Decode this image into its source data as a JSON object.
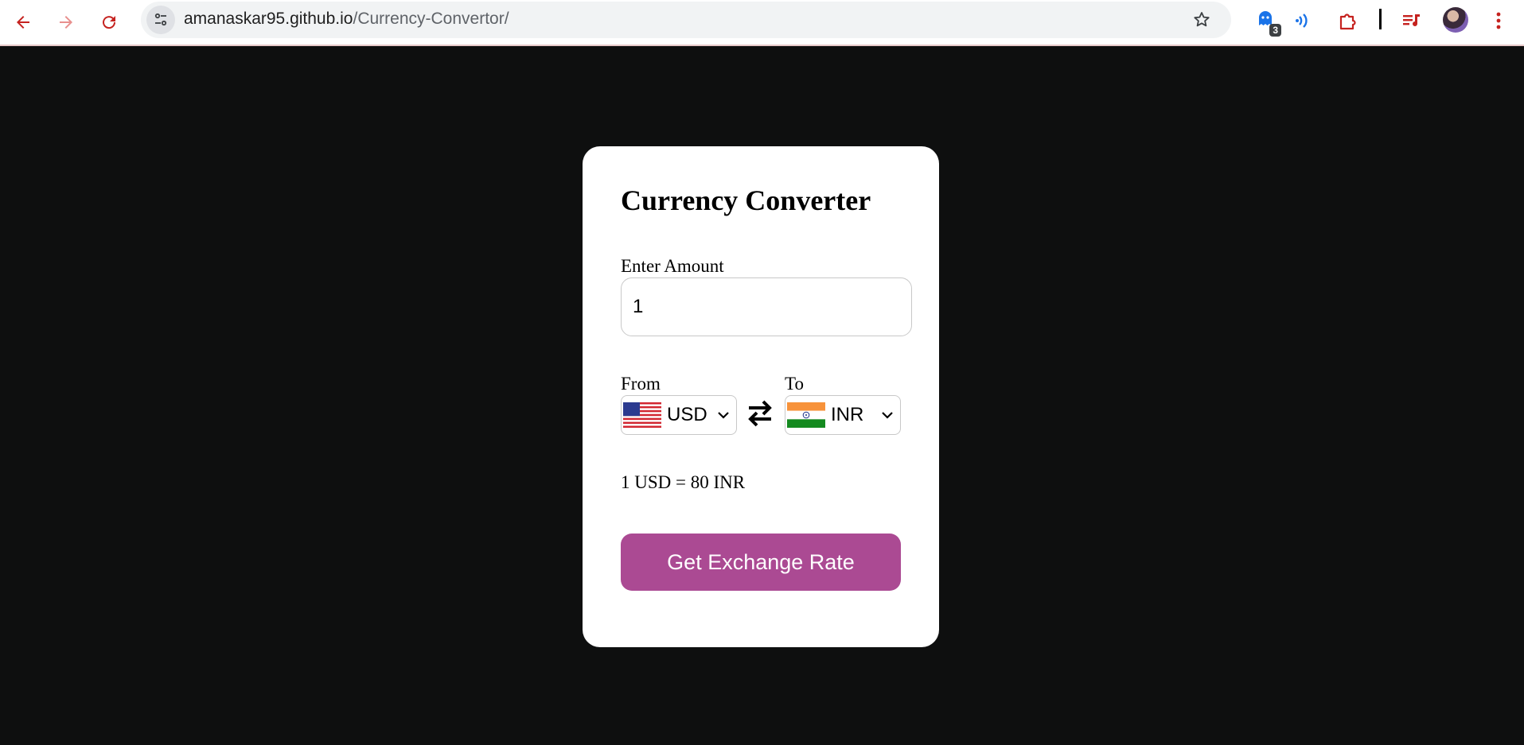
{
  "browser": {
    "url_host": "amanaskar95.github.io",
    "url_path": "/Currency-Convertor/",
    "extension_badge": "3",
    "icons": [
      "back-arrow-icon",
      "forward-arrow-icon",
      "reload-icon",
      "site-info-icon",
      "bookmark-star-icon",
      "extension-icon",
      "read-aloud-icon",
      "puzzle-extensions-icon",
      "media-queue-icon",
      "profile-avatar",
      "more-menu-icon"
    ],
    "accent_color": "#c5221f"
  },
  "card": {
    "title": "Currency Converter",
    "amount_label": "Enter Amount",
    "amount_value": "1",
    "from_label": "From",
    "to_label": "To",
    "from_currency": "USD",
    "to_currency": "INR",
    "rate_message": "1 USD = 80 INR",
    "button_label": "Get Exchange Rate",
    "button_color": "#ab4a93"
  },
  "page": {
    "background_color": "#0e0f0f"
  }
}
